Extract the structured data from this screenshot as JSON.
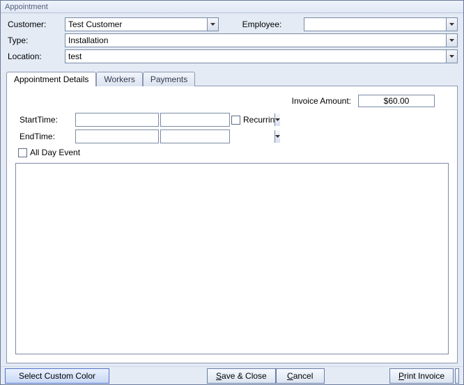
{
  "window": {
    "title": "Appointment"
  },
  "header": {
    "customer_label": "Customer:",
    "customer_value": "Test Customer",
    "employee_label": "Employee:",
    "employee_value": "",
    "type_label": "Type:",
    "type_value": "Installation",
    "location_label": "Location:",
    "location_value": "test"
  },
  "tabs": {
    "details": "Appointment Details",
    "workers": "Workers",
    "payments": "Payments"
  },
  "details": {
    "invoice_label": "Invoice Amount:",
    "invoice_value": "$60.00",
    "starttime_label": "StartTime:",
    "starttime_date": "",
    "starttime_time": "",
    "endtime_label": "EndTime:",
    "endtime_date": "",
    "endtime_time": "",
    "recurring_label": "Recurring",
    "allday_label": "All Day Event",
    "notes": ""
  },
  "footer": {
    "select_color": "Select Custom Color",
    "save_close_pre": "S",
    "save_close_post": "ave & Close",
    "cancel_pre": "C",
    "cancel_post": "ancel",
    "print_pre": "P",
    "print_post": "rint Invoice"
  }
}
